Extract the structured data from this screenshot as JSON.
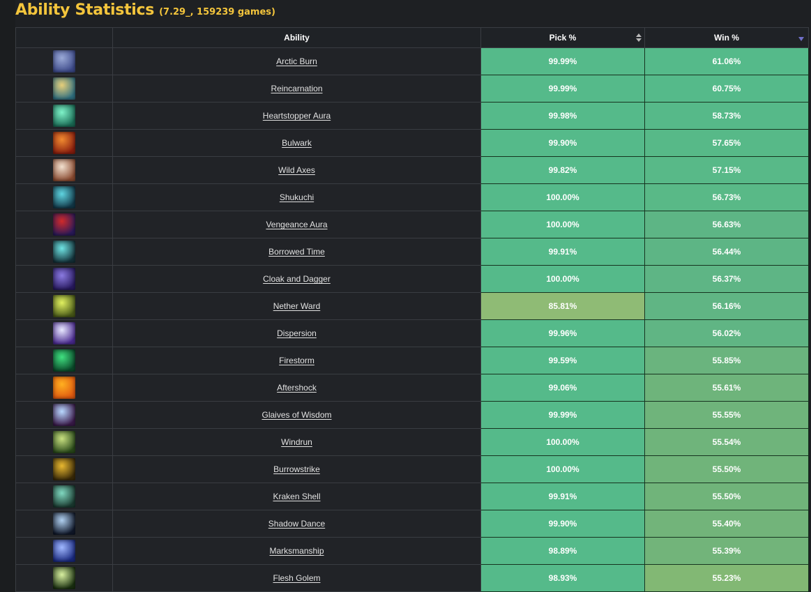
{
  "page": {
    "title": "Ability Statistics",
    "subtitle": "(7.29_, 159239 games)"
  },
  "table": {
    "columns": [
      {
        "key": "icon",
        "label": ""
      },
      {
        "key": "ability",
        "label": "Ability"
      },
      {
        "key": "pick",
        "label": "Pick %",
        "sort": "unsorted"
      },
      {
        "key": "win",
        "label": "Win %",
        "sort": "descending"
      }
    ],
    "rows": [
      {
        "ability": "Arctic Burn",
        "pick": "99.99%",
        "win": "61.06%",
        "icon": "arctic-burn-icon",
        "icon_colors": [
          "#9aa9d6",
          "#3d4a8a"
        ],
        "pick_color": "#55ba8a",
        "win_color": "#55ba8a"
      },
      {
        "ability": "Reincarnation",
        "pick": "99.99%",
        "win": "60.75%",
        "icon": "reincarnation-icon",
        "icon_colors": [
          "#e7cf7a",
          "#2f6f80"
        ],
        "pick_color": "#55ba8a",
        "win_color": "#55ba8a"
      },
      {
        "ability": "Heartstopper Aura",
        "pick": "99.98%",
        "win": "58.73%",
        "icon": "heartstopper-aura-icon",
        "icon_colors": [
          "#7ff2c8",
          "#1a6b55"
        ],
        "pick_color": "#55ba8a",
        "win_color": "#56b989"
      },
      {
        "ability": "Bulwark",
        "pick": "99.90%",
        "win": "57.65%",
        "icon": "bulwark-icon",
        "icon_colors": [
          "#f08a30",
          "#8a1e0e"
        ],
        "pick_color": "#55ba8a",
        "win_color": "#57b988"
      },
      {
        "ability": "Wild Axes",
        "pick": "99.82%",
        "win": "57.15%",
        "icon": "wild-axes-icon",
        "icon_colors": [
          "#f1e0cf",
          "#8a4a30"
        ],
        "pick_color": "#55ba8a",
        "win_color": "#58b988"
      },
      {
        "ability": "Shukuchi",
        "pick": "100.00%",
        "win": "56.73%",
        "icon": "shukuchi-icon",
        "icon_colors": [
          "#5fd4e0",
          "#123848"
        ],
        "pick_color": "#55ba8a",
        "win_color": "#59b987"
      },
      {
        "ability": "Vengeance Aura",
        "pick": "100.00%",
        "win": "56.63%",
        "icon": "vengeance-aura-icon",
        "icon_colors": [
          "#d02a2a",
          "#2a1a5a"
        ],
        "pick_color": "#55ba8a",
        "win_color": "#5db585"
      },
      {
        "ability": "Borrowed Time",
        "pick": "99.91%",
        "win": "56.44%",
        "icon": "borrowed-time-icon",
        "icon_colors": [
          "#6fe4e4",
          "#14323a"
        ],
        "pick_color": "#55ba8a",
        "win_color": "#5db585"
      },
      {
        "ability": "Cloak and Dagger",
        "pick": "100.00%",
        "win": "56.37%",
        "icon": "cloak-and-dagger-icon",
        "icon_colors": [
          "#8a7ae0",
          "#281a60"
        ],
        "pick_color": "#55ba8a",
        "win_color": "#5eb585"
      },
      {
        "ability": "Nether Ward",
        "pick": "85.81%",
        "win": "56.16%",
        "icon": "nether-ward-icon",
        "icon_colors": [
          "#e0f060",
          "#4a5a18"
        ],
        "pick_color": "#8fbb75",
        "win_color": "#60b584"
      },
      {
        "ability": "Dispersion",
        "pick": "99.96%",
        "win": "56.02%",
        "icon": "dispersion-icon",
        "icon_colors": [
          "#e8e8ff",
          "#4a2a90"
        ],
        "pick_color": "#55ba8a",
        "win_color": "#60b584"
      },
      {
        "ability": "Firestorm",
        "pick": "99.59%",
        "win": "55.85%",
        "icon": "firestorm-icon",
        "icon_colors": [
          "#40e080",
          "#0a4a2a"
        ],
        "pick_color": "#55ba8a",
        "win_color": "#6ab47e"
      },
      {
        "ability": "Aftershock",
        "pick": "99.06%",
        "win": "55.61%",
        "icon": "aftershock-icon",
        "icon_colors": [
          "#ffb020",
          "#e05a10"
        ],
        "pick_color": "#55ba8a",
        "win_color": "#6eb47b"
      },
      {
        "ability": "Glaives of Wisdom",
        "pick": "99.99%",
        "win": "55.55%",
        "icon": "glaives-of-wisdom-icon",
        "icon_colors": [
          "#b8d8ff",
          "#3a1a4a"
        ],
        "pick_color": "#55ba8a",
        "win_color": "#6fb47b"
      },
      {
        "ability": "Windrun",
        "pick": "100.00%",
        "win": "55.54%",
        "icon": "windrun-icon",
        "icon_colors": [
          "#c8e080",
          "#2a4a1a"
        ],
        "pick_color": "#55ba8a",
        "win_color": "#6fb47b"
      },
      {
        "ability": "Burrowstrike",
        "pick": "100.00%",
        "win": "55.50%",
        "icon": "burrowstrike-icon",
        "icon_colors": [
          "#e8b830",
          "#3a2a08"
        ],
        "pick_color": "#55ba8a",
        "win_color": "#70b47a"
      },
      {
        "ability": "Kraken Shell",
        "pick": "99.91%",
        "win": "55.50%",
        "icon": "kraken-shell-icon",
        "icon_colors": [
          "#80d8c0",
          "#1a3a30"
        ],
        "pick_color": "#55ba8a",
        "win_color": "#70b47a"
      },
      {
        "ability": "Shadow Dance",
        "pick": "99.90%",
        "win": "55.40%",
        "icon": "shadow-dance-icon",
        "icon_colors": [
          "#b0d0f0",
          "#10182a"
        ],
        "pick_color": "#55ba8a",
        "win_color": "#72b47a"
      },
      {
        "ability": "Marksmanship",
        "pick": "98.89%",
        "win": "55.39%",
        "icon": "marksmanship-icon",
        "icon_colors": [
          "#a0b8ff",
          "#1a2a80"
        ],
        "pick_color": "#55ba8a",
        "win_color": "#72b47a"
      },
      {
        "ability": "Flesh Golem",
        "pick": "98.93%",
        "win": "55.23%",
        "icon": "flesh-golem-icon",
        "icon_colors": [
          "#d8f0a0",
          "#1a3010"
        ],
        "pick_color": "#55ba8a",
        "win_color": "#82b874"
      }
    ]
  }
}
